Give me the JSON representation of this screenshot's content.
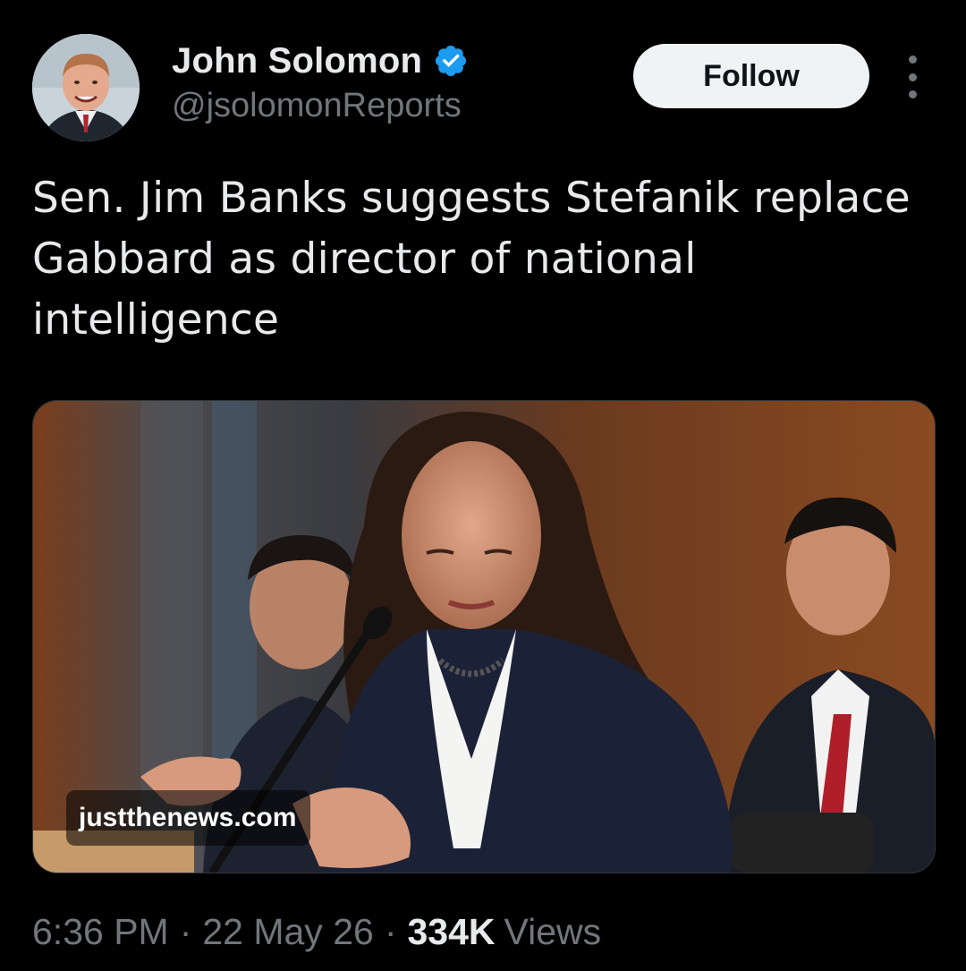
{
  "author": {
    "display_name": "John Solomon",
    "handle": "@jsolomonReports",
    "verified": true,
    "avatar_icon": "profile-photo"
  },
  "actions": {
    "follow_label": "Follow",
    "more_icon": "more-vertical-icon"
  },
  "tweet": {
    "text": "Sen. Jim Banks suggests Stefanik replace Gabbard as director of national intelligence"
  },
  "media": {
    "source_label": "justthenews.com"
  },
  "meta": {
    "time": "6:36 PM",
    "separator": "·",
    "date": "22 May 26",
    "views_count": "334K",
    "views_label": "Views"
  },
  "colors": {
    "background": "#000000",
    "primary_text": "#e7e9ea",
    "secondary_text": "#71767b",
    "verified_blue": "#1d9bf0",
    "follow_bg": "#eff3f4"
  }
}
